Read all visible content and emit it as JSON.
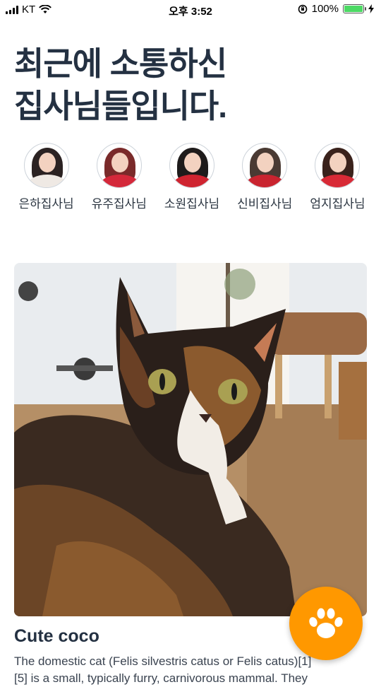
{
  "status_bar": {
    "carrier": "KT",
    "time": "오후 3:52",
    "battery_percent": "100%",
    "battery_level": 1.0,
    "icons": [
      "signal-icon",
      "wifi-icon",
      "orientation-lock-icon",
      "battery-icon",
      "charging-icon"
    ]
  },
  "headline": "최근에 소통하신\n집사님들입니다.",
  "recent_users": [
    {
      "name": "은하집사님",
      "hair": "#2b2222",
      "shirt": "#efe9e4"
    },
    {
      "name": "유주집사님",
      "hair": "#7a2a2a",
      "shirt": "#d4283a"
    },
    {
      "name": "소원집사님",
      "hair": "#1e1b1b",
      "shirt": "#cf2430"
    },
    {
      "name": "신비집사님",
      "hair": "#4a3a33",
      "shirt": "#c9242f"
    },
    {
      "name": "엄지집사님",
      "hair": "#3a221c",
      "shirt": "#d82a36"
    }
  ],
  "post": {
    "title": "Cute coco",
    "description_line1": "The domestic cat (Felis silvestris catus or Felis catus)[1]",
    "description_line2": "[5] is a small, typically furry, carnivorous mammal. They"
  },
  "fab": {
    "icon": "paw-icon",
    "color": "#ff9800"
  }
}
